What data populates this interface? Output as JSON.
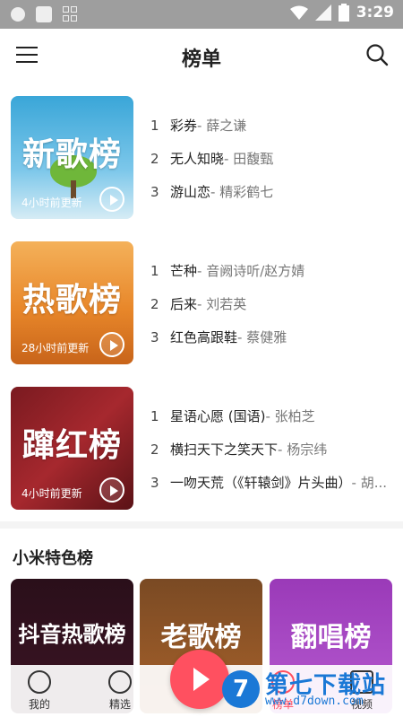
{
  "status_bar": {
    "time": "3:29"
  },
  "header": {
    "title": "榜单"
  },
  "ranks": [
    {
      "cover_title": "新歌榜",
      "updated": "4小时前更新",
      "songs": [
        {
          "num": "1",
          "name": "彩券",
          "artist": " - 薛之谦"
        },
        {
          "num": "2",
          "name": "无人知晓",
          "artist": " - 田馥甄"
        },
        {
          "num": "3",
          "name": "游山恋",
          "artist": " - 精彩鹤七"
        }
      ]
    },
    {
      "cover_title": "热歌榜",
      "updated": "28小时前更新",
      "songs": [
        {
          "num": "1",
          "name": "芒种",
          "artist": " - 音阙诗听/赵方婧"
        },
        {
          "num": "2",
          "name": "后来",
          "artist": " - 刘若英"
        },
        {
          "num": "3",
          "name": "红色高跟鞋",
          "artist": " - 蔡健雅"
        }
      ]
    },
    {
      "cover_title": "蹿红榜",
      "updated": "4小时前更新",
      "songs": [
        {
          "num": "1",
          "name": "星语心愿 (国语)",
          "artist": " - 张柏芝"
        },
        {
          "num": "2",
          "name": "横扫天下之笑天下",
          "artist": " - 杨宗纬"
        },
        {
          "num": "3",
          "name": "一吻天荒（《轩辕剑》片头曲）",
          "artist": " - 胡..."
        }
      ]
    }
  ],
  "section": {
    "title": "小米特色榜"
  },
  "featured": [
    {
      "title": "抖音热歌榜"
    },
    {
      "title": "老歌榜"
    },
    {
      "title": "翻唱榜"
    }
  ],
  "bottom_nav": {
    "mine": "我的",
    "picks": "精选",
    "charts": "榜单",
    "video": "视频"
  },
  "watermark": {
    "logo": "7",
    "text": "第七下载站",
    "url": "www.d7down.com"
  },
  "colors": {
    "accent": "#ff5060",
    "cover1": "#3aa6d8",
    "cover2": "#e8872a",
    "cover3": "#a6282e"
  }
}
